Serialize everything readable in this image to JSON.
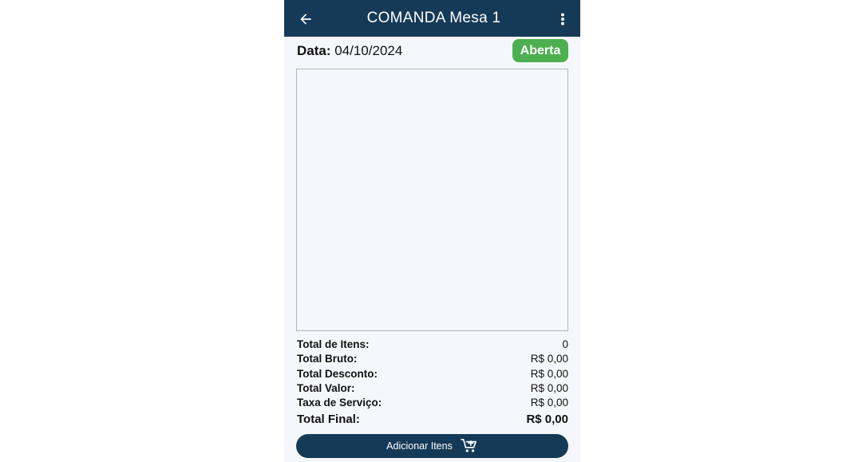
{
  "appbar": {
    "title": "COMANDA Mesa 1",
    "back_icon": "arrow-left-icon",
    "menu_icon": "more-vertical-icon",
    "color": "#153a57"
  },
  "order": {
    "date_label": "Data:",
    "date_value": "04/10/2024",
    "status": "Aberta",
    "status_color": "#4caf50"
  },
  "totals": [
    {
      "label": "Total de Itens:",
      "value": "0"
    },
    {
      "label": "Total Bruto:",
      "value": "R$ 0,00"
    },
    {
      "label": "Total Desconto:",
      "value": "R$ 0,00"
    },
    {
      "label": "Total Valor:",
      "value": "R$ 0,00"
    },
    {
      "label": "Taxa de Serviço:",
      "value": "R$ 0,00"
    }
  ],
  "total_final": {
    "label": "Total Final:",
    "value": "R$ 0,00"
  },
  "add_button": {
    "label": "Adicionar Itens",
    "icon": "cart-plus-icon"
  }
}
